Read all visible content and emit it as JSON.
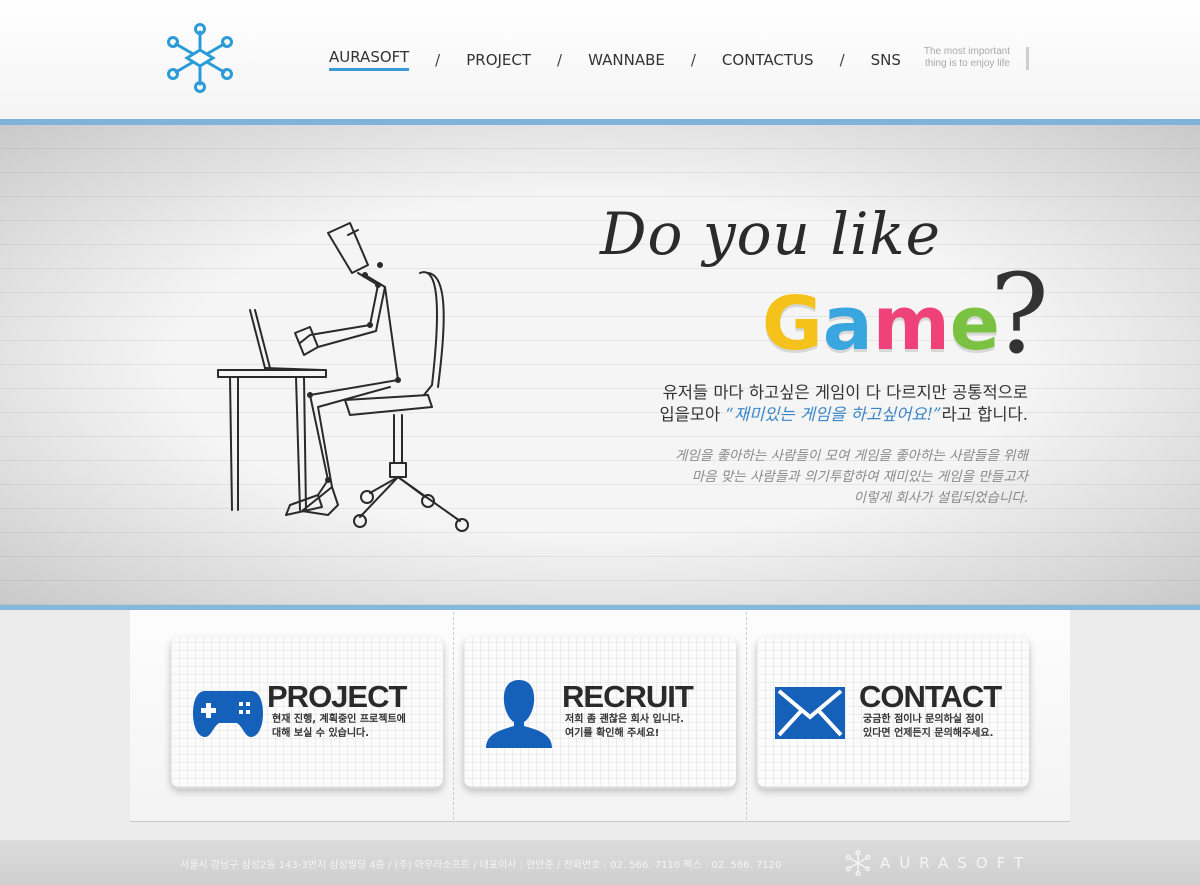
{
  "nav": {
    "items": [
      "AURASOFT",
      "PROJECT",
      "WANNABE",
      "CONTACTUS",
      "SNS"
    ],
    "separator": "/",
    "active": "AURASOFT"
  },
  "tagline": {
    "line1": "The most important",
    "line2": "thing is to enjoy life"
  },
  "hero": {
    "headline": "Do you like",
    "game_letters": [
      "G",
      "a",
      "m",
      "e"
    ],
    "game_colors": [
      "#f5c21b",
      "#3aa6df",
      "#f0427a",
      "#7cc242"
    ],
    "question": "?",
    "lead_line1": "유저들 마다 하고싶은 게임이 다 다르지만 공통적으로",
    "lead_line2_before": "입을모아 ",
    "lead_line2_quote": "“재미있는 게임을 하고싶어요!”",
    "lead_line2_after": "라고 합니다.",
    "desc_line1": "게임을 좋아하는 사람들이 모여 게임을 좋아하는 사람들을 위해",
    "desc_line2": "마음 맞는 사람들과 의기투합하여 재미있는 게임을 만들고자",
    "desc_line3": "이렇게 회사가 설립되었습니다."
  },
  "cards": [
    {
      "title": "PROJECT",
      "line1": "현재 진행, 계획중인 프로젝트에",
      "line2": "대해 보실 수 있습니다.",
      "icon": "gamepad-icon"
    },
    {
      "title": "RECRUIT",
      "line1": "저희 좀 괜찮은 회사 입니다.",
      "line2": "여기를 확인해 주세요!",
      "icon": "person-icon"
    },
    {
      "title": "CONTACT",
      "line1": "궁금한  점이나  문의하실  점이",
      "line2": "있다면 언제든지 문의해주세요.",
      "icon": "envelope-icon"
    }
  ],
  "footer": {
    "address": "서울시 강남구 삼성2동 143-3번지 삼성빌딩 4층 / (주) 아우라소프트 / 대표이사 : 한만준 / 전화번호 : 02. 566. 7110  팩스 : 02. 566. 7120",
    "brand": "AURASOFT"
  },
  "colors": {
    "accent": "#3a9ad9",
    "icon_blue": "#1560b8",
    "hero_border": "#7fb3d8"
  }
}
